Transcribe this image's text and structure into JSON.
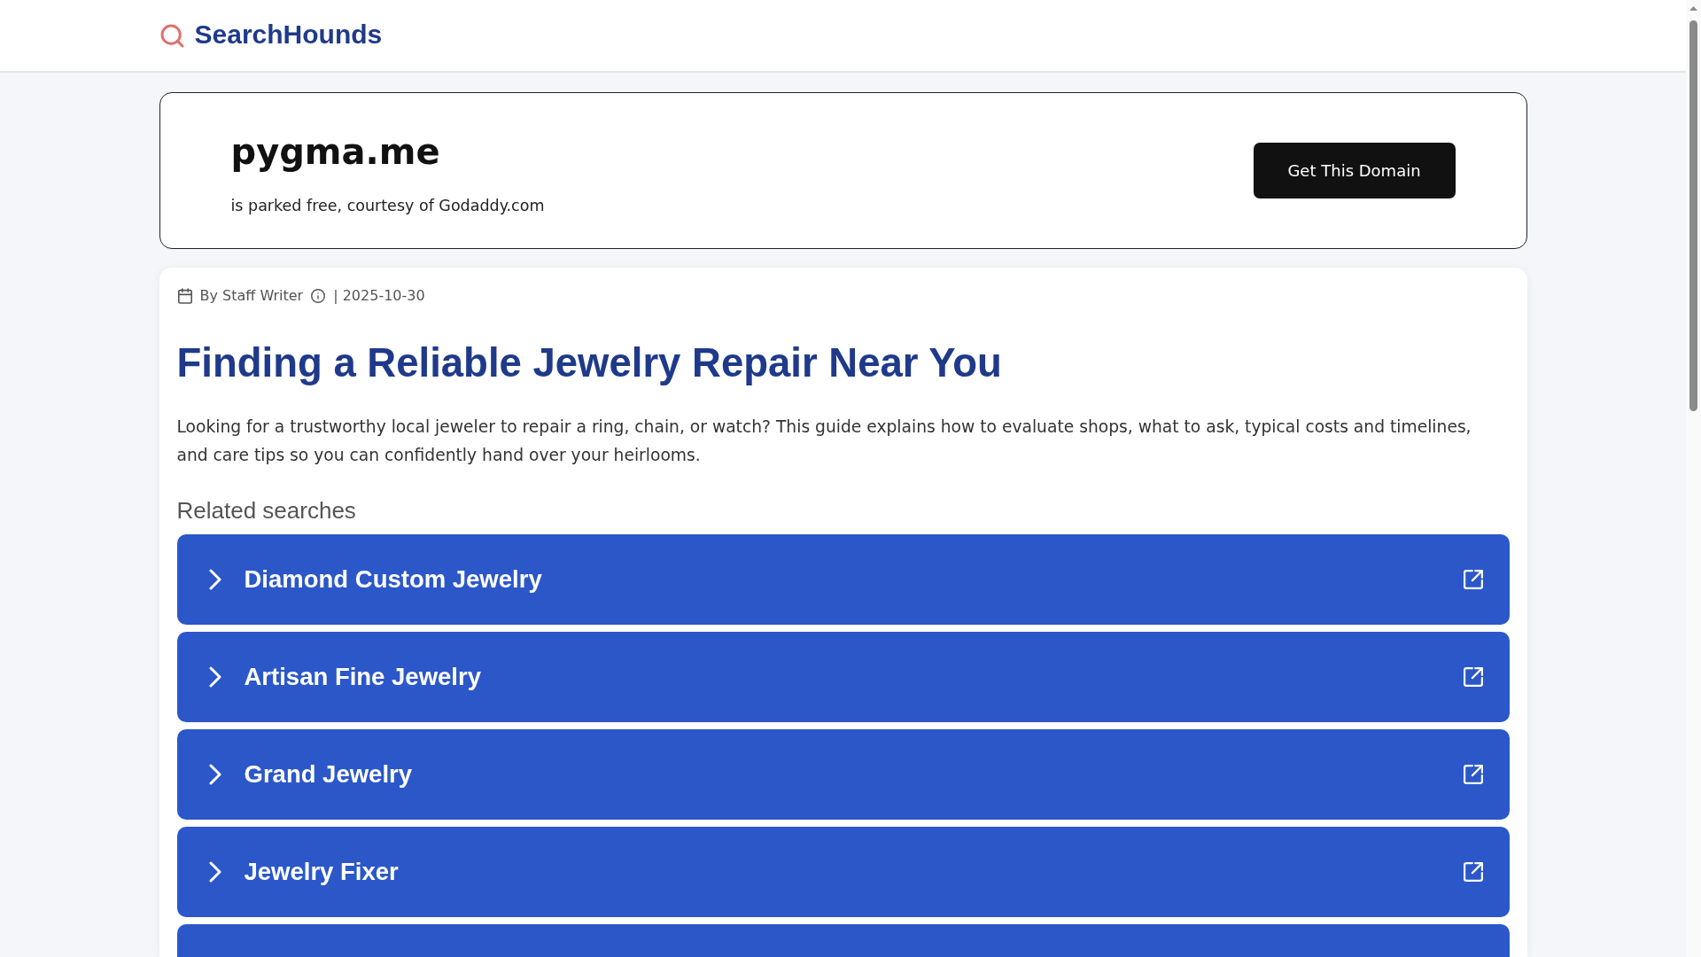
{
  "header": {
    "logo": "SearchHounds"
  },
  "domain_banner": {
    "domain": "pygma.me",
    "subtitle": "is parked free, courtesy of Godaddy.com",
    "button": "Get This Domain"
  },
  "article": {
    "byline": "By Staff Writer",
    "date": "| 2025-10-30",
    "title": "Finding a Reliable Jewelry Repair Near You",
    "summary": "Looking for a trustworthy local jeweler to repair a ring, chain, or watch? This guide explains how to evaluate shops, what to ask, typical costs and timelines, and care tips so you can confidently hand over your heirlooms.",
    "related_heading": "Related searches",
    "related_searches": [
      {
        "kind": "link",
        "label": "Diamond Custom Jewelry"
      },
      {
        "kind": "link",
        "label": "Artisan Fine Jewelry"
      },
      {
        "kind": "link",
        "label": "Grand Jewelry"
      },
      {
        "kind": "link",
        "label": "Jewelry Fixer"
      },
      {
        "kind": "cut_off"
      }
    ]
  }
}
